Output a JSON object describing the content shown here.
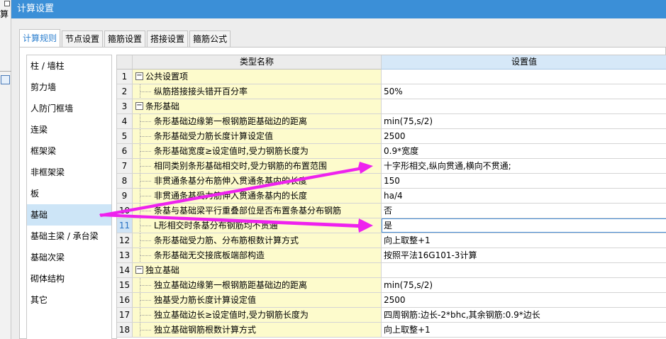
{
  "titlebar": {
    "title": "计算设置"
  },
  "edge": {
    "fragment": "算"
  },
  "tabs": [
    "计算规则",
    "节点设置",
    "箍筋设置",
    "搭接设置",
    "箍筋公式"
  ],
  "active_tab": 0,
  "sidebar": {
    "items": [
      "柱 / 墙柱",
      "剪力墙",
      "人防门框墙",
      "连梁",
      "框架梁",
      "非框架梁",
      "板",
      "基础",
      "基础主梁 / 承台梁",
      "基础次梁",
      "砌体结构",
      "其它"
    ],
    "selected": 7
  },
  "grid": {
    "col_name": "类型名称",
    "col_value": "设置值",
    "rows": [
      {
        "num": "1",
        "name": "公共设置项",
        "value": "",
        "kind": "group",
        "expander": "−"
      },
      {
        "num": "2",
        "name": "纵筋搭接接头错开百分率",
        "value": "50%",
        "kind": "child"
      },
      {
        "num": "3",
        "name": "条形基础",
        "value": "",
        "kind": "group",
        "expander": "−"
      },
      {
        "num": "4",
        "name": "条形基础边缘第一根钢筋距基础边的距离",
        "value": "min(75,s/2)",
        "kind": "child"
      },
      {
        "num": "5",
        "name": "条形基础受力筋长度计算设定值",
        "value": "2500",
        "kind": "child"
      },
      {
        "num": "6",
        "name": "条形基础宽度≥设定值时,受力钢筋长度为",
        "value": "0.9*宽度",
        "kind": "child"
      },
      {
        "num": "7",
        "name": "相同类别条形基础相交时,受力钢筋的布置范围",
        "value": "十字形相交,纵向贯通,横向不贯通;",
        "kind": "child"
      },
      {
        "num": "8",
        "name": "非贯通条基分布筋伸入贯通条基内的长度",
        "value": "150",
        "kind": "child"
      },
      {
        "num": "9",
        "name": "非贯通条基受力筋伸入贯通条基内的长度",
        "value": "ha/4",
        "kind": "child"
      },
      {
        "num": "10",
        "name": "条基与基础梁平行重叠部位是否布置条基分布钢筋",
        "value": "否",
        "kind": "child"
      },
      {
        "num": "11",
        "name": "L形相交时条基分布钢筋均不贯通",
        "value": "是",
        "kind": "child",
        "current": true
      },
      {
        "num": "12",
        "name": "条形基础受力筋、分布筋根数计算方式",
        "value": "向上取整+1",
        "kind": "child"
      },
      {
        "num": "13",
        "name": "条形基础无交接底板端部构造",
        "value": "按照平法16G101-3计算",
        "kind": "child"
      },
      {
        "num": "14",
        "name": "独立基础",
        "value": "",
        "kind": "group",
        "expander": "−"
      },
      {
        "num": "15",
        "name": "独立基础边缘第一根钢筋距基础边的距离",
        "value": "min(75,s/2)",
        "kind": "child"
      },
      {
        "num": "16",
        "name": "独基受力筋长度计算设定值",
        "value": "2500",
        "kind": "child"
      },
      {
        "num": "17",
        "name": "独立基础边长≥设定值时,受力钢筋长度为",
        "value": "四周钢筋:边长-2*bhc,其余钢筋:0.9*边长",
        "kind": "child"
      },
      {
        "num": "18",
        "name": "独立基础钢筋根数计算方式",
        "value": "向上取整+1",
        "kind": "child"
      }
    ]
  },
  "colors": {
    "titlebar": "#3b8fd7",
    "name_cell": "#fdfbcc",
    "annotation_arrow": "#ee22ee",
    "selected": "#cde5f7"
  }
}
